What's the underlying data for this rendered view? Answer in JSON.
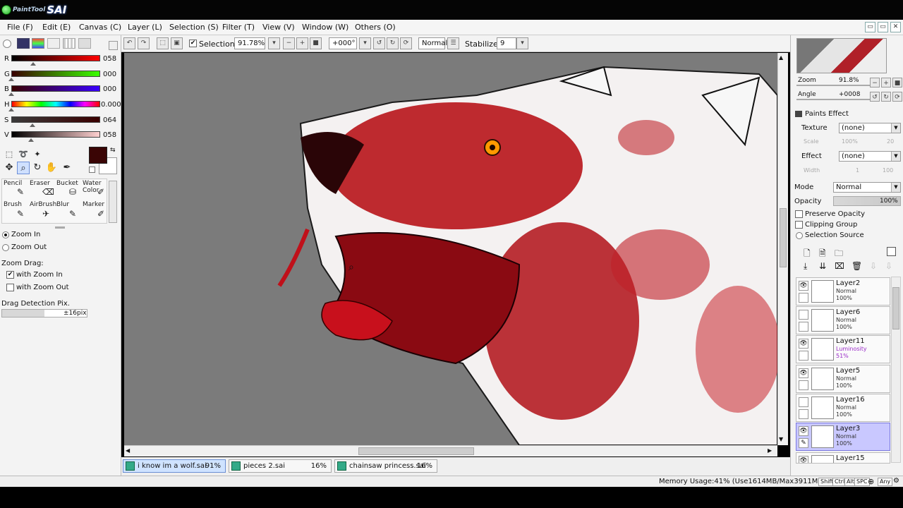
{
  "app": {
    "logo_small": "PaintTool",
    "logo_big": "SAI"
  },
  "menu": [
    "File (F)",
    "Edit (E)",
    "Canvas (C)",
    "Layer (L)",
    "Selection (S)",
    "Filter (T)",
    "View (V)",
    "Window (W)",
    "Others (O)"
  ],
  "window_buttons": [
    "▭",
    "▭",
    "▭",
    "✕"
  ],
  "color_sliders": [
    {
      "label": "R",
      "value": "058",
      "color": "#3a0000"
    },
    {
      "label": "G",
      "value": "000",
      "color": "#00cc00"
    },
    {
      "label": "B",
      "value": "000",
      "color": "#0000dd"
    },
    {
      "label": "H",
      "value": "0.000",
      "color": "#ff0000"
    },
    {
      "label": "S",
      "value": "064",
      "color": "#6b2222"
    },
    {
      "label": "V",
      "value": "058",
      "color": "#3a0a0a"
    }
  ],
  "current_color": "#3a0505",
  "brushes": [
    {
      "label": "Pencil",
      "icon": "✎"
    },
    {
      "label": "Eraser",
      "icon": "⌫"
    },
    {
      "label": "Bucket",
      "icon": "⛁"
    },
    {
      "label": "Water Color",
      "icon": "✐"
    },
    {
      "label": "Brush",
      "icon": "✎"
    },
    {
      "label": "AirBrush",
      "icon": "✈"
    },
    {
      "label": "Blur",
      "icon": "✎"
    },
    {
      "label": "Marker",
      "icon": "✐"
    }
  ],
  "zoom_options": {
    "zoom_in": "Zoom In",
    "zoom_out": "Zoom Out"
  },
  "zoom_drag": {
    "title": "Zoom Drag:",
    "with_zoom_in": "with Zoom In",
    "with_zoom_out": "with Zoom Out"
  },
  "drag_detection": {
    "label": "Drag Detection Pix.",
    "value": "±16pix"
  },
  "topbar": {
    "selection_label": "Selection",
    "zoom": "91.78%",
    "angle": "+000°",
    "blend": "Normal",
    "stabilizer_label": "Stabilizer",
    "stabilizer_value": "9"
  },
  "navigator": {
    "zoom_label": "Zoom",
    "zoom_value": "91.8%",
    "angle_label": "Angle",
    "angle_value": "+0008"
  },
  "paints_effect": {
    "title": "Paints Effect",
    "texture_label": "Texture",
    "texture_value": "(none)",
    "scale_label": "Scale",
    "scale_value": "100%",
    "scale_num": "20",
    "effect_label": "Effect",
    "effect_value": "(none)",
    "width_label": "Width",
    "width_value": "1",
    "width_num": "100"
  },
  "layer_props": {
    "mode_label": "Mode",
    "mode_value": "Normal",
    "opacity_label": "Opacity",
    "opacity_value": "100%",
    "preserve_opacity": "Preserve Opacity",
    "clipping_group": "Clipping Group",
    "selection_source": "Selection Source"
  },
  "layers": [
    {
      "name": "Layer2",
      "mode": "Normal",
      "opacity": "100%",
      "visible": true,
      "selected": false
    },
    {
      "name": "Layer6",
      "mode": "Normal",
      "opacity": "100%",
      "visible": false,
      "selected": false
    },
    {
      "name": "Layer11",
      "mode": "Luminosity",
      "opacity": "51%",
      "visible": true,
      "selected": false
    },
    {
      "name": "Layer5",
      "mode": "Normal",
      "opacity": "100%",
      "visible": true,
      "selected": false
    },
    {
      "name": "Layer16",
      "mode": "Normal",
      "opacity": "100%",
      "visible": false,
      "selected": false
    },
    {
      "name": "Layer3",
      "mode": "Normal",
      "opacity": "100%",
      "visible": true,
      "selected": true
    },
    {
      "name": "Layer15",
      "mode": "",
      "opacity": "",
      "visible": true,
      "selected": false
    }
  ],
  "documents": [
    {
      "name": "i know im a wolf.sai",
      "percent": "91%",
      "active": true
    },
    {
      "name": "pieces 2.sai",
      "percent": "16%",
      "active": false
    },
    {
      "name": "chainsaw princess.sai",
      "percent": "16%",
      "active": false
    }
  ],
  "status": {
    "memory": "Memory Usage:41% (Use1614MB/Max3911MB)",
    "keys": [
      "Shift",
      "Ctrl",
      "Alt",
      "SPC",
      "Any"
    ]
  }
}
